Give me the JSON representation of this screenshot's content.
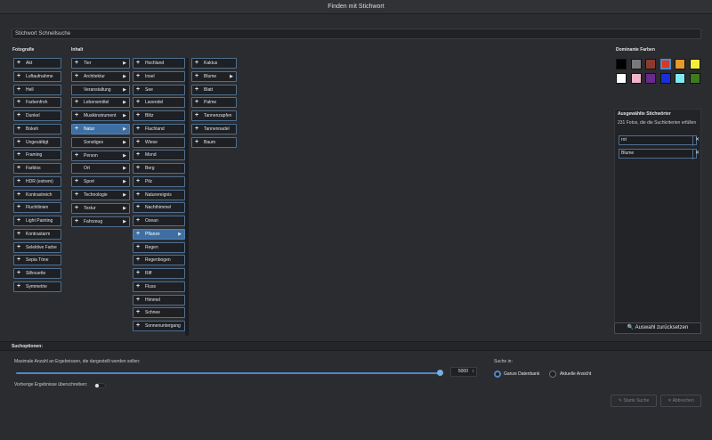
{
  "window": {
    "title": "Finden mit Stichwort"
  },
  "quick_search": {
    "placeholder": "Stichwort Schnellsuche"
  },
  "columns": {
    "fotografie": {
      "header": "Fotografie",
      "items": [
        "Akt",
        "Luftaufnahme",
        "Hell",
        "Farbenfroh",
        "Dunkel",
        "Bokeh",
        "Ungesättigt",
        "Framing",
        "Farblos",
        "HDR (extrem)",
        "Kontrastreich",
        "Fluchtlinien",
        "Light Painting",
        "Kontrastarm",
        "Selektive Farbe",
        "Sepia Töne",
        "Silhouette",
        "Symmetrie"
      ]
    },
    "inhalt": {
      "header": "Inhalt",
      "items": [
        {
          "label": "Tier",
          "plus": true,
          "arrow": true
        },
        {
          "label": "Architektur",
          "plus": true,
          "arrow": true
        },
        {
          "label": "Veranstaltung",
          "plus": false,
          "arrow": true
        },
        {
          "label": "Lebensmittel",
          "plus": true,
          "arrow": true
        },
        {
          "label": "Musikinstrument",
          "plus": true,
          "arrow": true
        },
        {
          "label": "Natur",
          "plus": true,
          "arrow": true,
          "selected": true
        },
        {
          "label": "Sonstiges",
          "plus": false,
          "arrow": true
        },
        {
          "label": "Person",
          "plus": true,
          "arrow": true
        },
        {
          "label": "Ort",
          "plus": false,
          "arrow": true
        },
        {
          "label": "Sport",
          "plus": true,
          "arrow": true
        },
        {
          "label": "Technologie",
          "plus": true,
          "arrow": true
        },
        {
          "label": "Textur",
          "plus": true,
          "arrow": true
        },
        {
          "label": "Fahrzeug",
          "plus": true,
          "arrow": true
        }
      ]
    },
    "natur": {
      "items": [
        {
          "label": "Hochland"
        },
        {
          "label": "Insel"
        },
        {
          "label": "See"
        },
        {
          "label": "Lavendel"
        },
        {
          "label": "Blitz"
        },
        {
          "label": "Flachland"
        },
        {
          "label": "Wiese"
        },
        {
          "label": "Mond"
        },
        {
          "label": "Berg"
        },
        {
          "label": "Pilz"
        },
        {
          "label": "Naturereignis"
        },
        {
          "label": "Nachthimmel"
        },
        {
          "label": "Ozean"
        },
        {
          "label": "Pflanze",
          "selected": true,
          "arrow": true
        },
        {
          "label": "Regen"
        },
        {
          "label": "Regenbogen"
        },
        {
          "label": "Riff"
        },
        {
          "label": "Fluss"
        },
        {
          "label": "Himmel"
        },
        {
          "label": "Schnee"
        },
        {
          "label": "Sonnenuntergang"
        }
      ]
    },
    "pflanze": {
      "items": [
        {
          "label": "Kaktus"
        },
        {
          "label": "Blume",
          "arrow": true
        },
        {
          "label": "Blatt"
        },
        {
          "label": "Palme"
        },
        {
          "label": "Tannenzapfen"
        },
        {
          "label": "Tannennadel"
        },
        {
          "label": "Baum"
        }
      ]
    }
  },
  "colors": {
    "header": "Dominante Farben",
    "swatches": [
      "#000000",
      "#7a7a7a",
      "#8b3a2f",
      "#d9381e",
      "#e59a2a",
      "#f2ef3a",
      "#ffffff",
      "#f0b4c8",
      "#6a2a8c",
      "#1a2fd6",
      "#7fe8f0",
      "#3e7a1e"
    ],
    "selected_index": 3
  },
  "keywords": {
    "header": "Ausgewählte Stichwörter",
    "count_text": "231 Fotos, die die Suchkriterien erfüllen",
    "items": [
      "rot",
      "Blume"
    ],
    "reset_label": "Auswahl zurücksetzen"
  },
  "options": {
    "header": "Suchoptionen:",
    "max_results_label": "Maximale Anzahl an Ergebnissen, die dargestellt werden sollen:",
    "max_results_value": "5000",
    "overwrite_label": "Vorherige Ergebnisse überschreiben:",
    "search_in_label": "Suche in:",
    "radio_all": "Ganze Datenbank",
    "radio_current": "Aktuelle Ansicht",
    "start_label": "Starte Suche",
    "cancel_label": "Abbrechen"
  }
}
